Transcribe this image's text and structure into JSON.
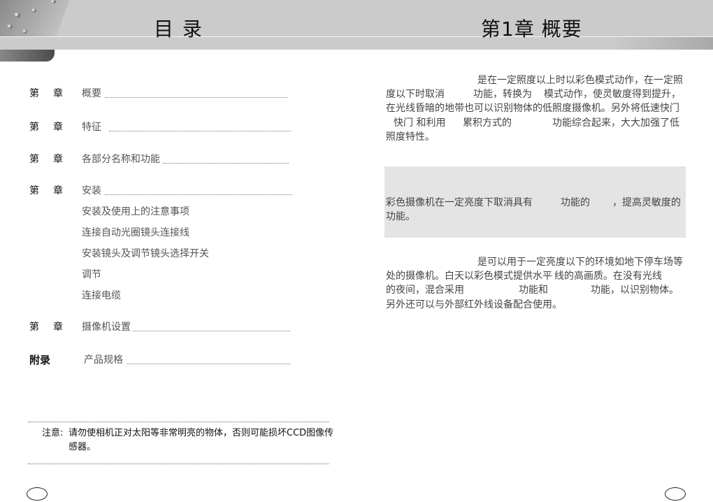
{
  "left_page": {
    "title": "目  录",
    "toc": [
      {
        "prefix": "第",
        "suffix": "章",
        "title": "概要"
      },
      {
        "prefix": "第",
        "suffix": "章",
        "title": "特征"
      },
      {
        "prefix": "第",
        "suffix": "章",
        "title": "各部分名称和功能"
      },
      {
        "prefix": "第",
        "suffix": "章",
        "title": "安装",
        "subitems": [
          "安装及使用上的注意事项",
          "连接自动光圈镜头连接线",
          "安装镜头及调节镜头选择开关",
          "调节",
          "连接电缆"
        ]
      },
      {
        "prefix": "第",
        "suffix": "章",
        "title": "摄像机设置"
      }
    ],
    "appendix": {
      "label": "附录",
      "title": "产品规格"
    },
    "note": {
      "label": "注意:",
      "line1": "请勿使相机正对太阳等非常明亮的物体，否则可能损坏CCD图像传",
      "line2": "感器。"
    }
  },
  "right_page": {
    "title": "第1章   概要",
    "para1": [
      "是在一定照度以上时以彩色模式动作，在一定照",
      "度以下时取消",
      "功能，转换为",
      "模式动作，使灵敏度得到提升，",
      "在光线昏暗的地带也可以识别物体的低照度摄像机。另外将低速快门",
      "快门 和利用",
      "累积方式的",
      "功能综合起来，大大加强了低",
      "照度特性。"
    ],
    "box": [
      "彩色摄像机在一定亮度下取消具有",
      "功能的",
      "，提高灵敏度的",
      "功能。"
    ],
    "para3": [
      "是可以用于一定亮度以下的环境如地下停车场等",
      "处的摄像机。白天以彩色模式提供水平",
      "线的高画质。在没有光线",
      "的夜间，混合采用",
      "功能和",
      "功能，以识别物体。",
      "另外还可以与外部红外线设备配合使用。"
    ]
  }
}
